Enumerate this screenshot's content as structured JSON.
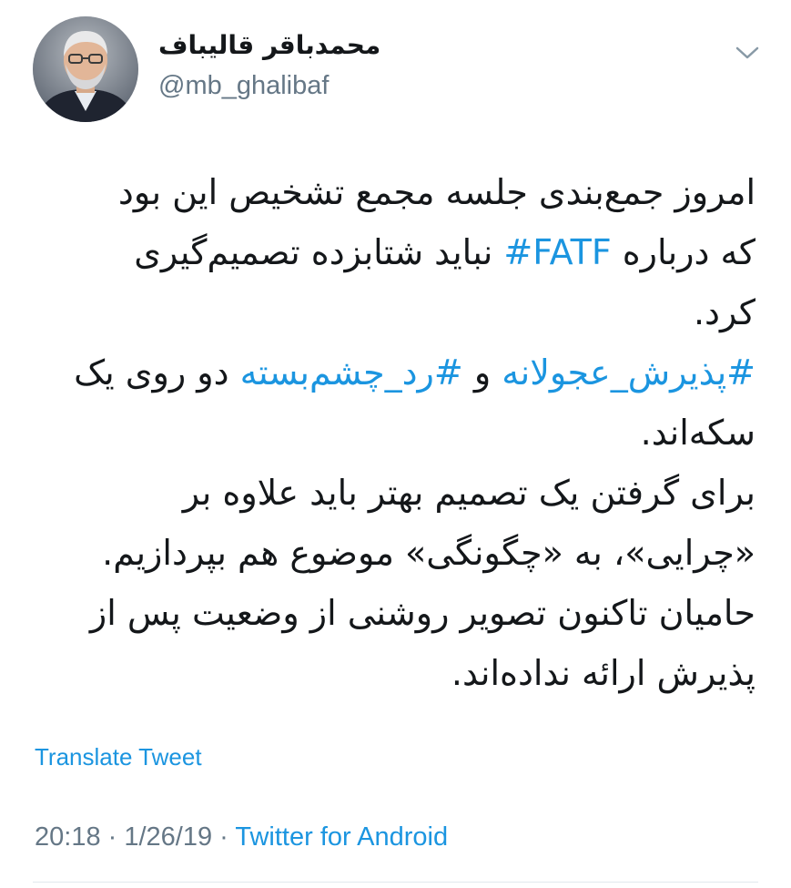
{
  "user": {
    "display_name": "محمدباقر قالیباف",
    "handle": "@mb_ghalibaf",
    "avatar_icon": "profile-photo"
  },
  "menu": {
    "icon": "chevron-down-icon"
  },
  "tweet": {
    "lines": [
      [
        "امروز جمع‌بندی جلسه مجمع تشخیص این بود"
      ],
      [
        "که درباره ",
        "#FATF",
        " نباید شتابزده تصمیم‌گیری"
      ],
      [
        "کرد."
      ],
      [
        "#پذیرش_عجولانه",
        " و ",
        "#رد_چشم‌بسته",
        " دو روی یک"
      ],
      [
        "سکه‌اند."
      ],
      [
        "برای گرفتن یک تصمیم بهتر باید علاوه بر"
      ],
      [
        "«چرایی»، به «چگونگی» موضوع هم بپردازیم."
      ],
      [
        "حامیان تاکنون تصویر روشنی از وضعیت پس از"
      ],
      [
        "پذیرش ارائه نداده‌اند."
      ]
    ],
    "hashtags": [
      "#FATF",
      "#پذیرش_عجولانه",
      "#رد_چشم‌بسته"
    ]
  },
  "translate_label": "Translate Tweet",
  "meta": {
    "time": "20:18",
    "separator1": " · ",
    "date": "1/26/19",
    "separator2": " · ",
    "source": "Twitter for Android"
  },
  "colors": {
    "link": "#1b95e0",
    "secondary": "#657786",
    "text": "#14171a"
  }
}
